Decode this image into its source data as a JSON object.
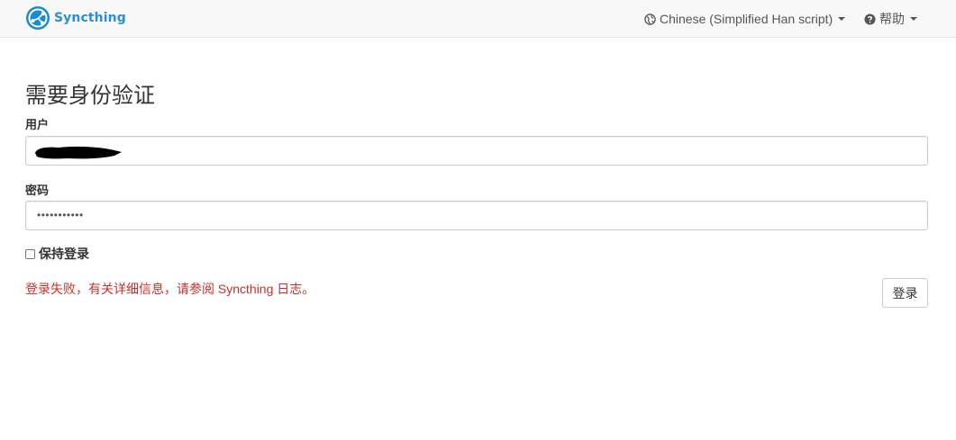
{
  "navbar": {
    "brand_name": "Syncthing",
    "brand_icon": "syncthing-logo-icon",
    "language": {
      "icon": "globe-icon",
      "label": "Chinese (Simplified Han script)"
    },
    "help": {
      "icon": "question-circle-icon",
      "label": "帮助"
    }
  },
  "login": {
    "title": "需要身份验证",
    "user_label": "用户",
    "user_value_redacted": true,
    "password_label": "密码",
    "password_value": "•••••••••••",
    "keep_logged_in_label": "保持登录",
    "keep_logged_in_checked": false,
    "error_message": "登录失败，有关详细信息，请参阅 Syncthing 日志。",
    "submit_label": "登录"
  },
  "colors": {
    "brand": "#2c8fd6",
    "error": "#c9302c",
    "navbar_bg": "#f8f8f8"
  }
}
